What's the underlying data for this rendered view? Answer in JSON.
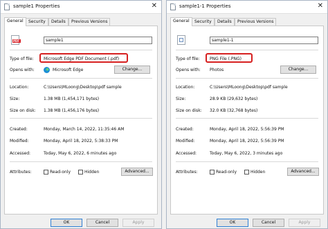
{
  "dialogs": [
    {
      "title": "sample1 Properties",
      "tabs": [
        "General",
        "Security",
        "Details",
        "Previous Versions"
      ],
      "file_name": "sample1",
      "type_label": "Type of file:",
      "type_value": "Microsoft Edge PDF Document (.pdf)",
      "opens_label": "Opens with:",
      "opens_value": "Microsoft Edge",
      "change_button": "Change...",
      "location_label": "Location:",
      "location_value": "C:\\Users\\MLoong\\Desktop\\pdf sample",
      "size_label": "Size:",
      "size_value": "1.38 MB (1,454,171 bytes)",
      "size_on_disk_label": "Size on disk:",
      "size_on_disk_value": "1.38 MB (1,456,176 bytes)",
      "created_label": "Created:",
      "created_value": "Monday, March 14, 2022, 11:35:46 AM",
      "modified_label": "Modified:",
      "modified_value": "Monday, April 18, 2022, 5:38:33 PM",
      "accessed_label": "Accessed:",
      "accessed_value": "Today, May 6, 2022, 6 minutes ago",
      "attributes_label": "Attributes:",
      "readonly_label": "Read-only",
      "hidden_label": "Hidden",
      "advanced_button": "Advanced...",
      "ok_button": "OK",
      "cancel_button": "Cancel",
      "apply_button": "Apply"
    },
    {
      "title": "sample1-1 Properties",
      "tabs": [
        "General",
        "Security",
        "Details",
        "Previous Versions"
      ],
      "file_name": "sample1-1",
      "type_label": "Type of file:",
      "type_value": "PNG File (.PNG)",
      "opens_label": "Opens with:",
      "opens_value": "Photos",
      "change_button": "Change...",
      "location_label": "Location:",
      "location_value": "C:\\Users\\MLoong\\Desktop\\pdf sample",
      "size_label": "Size:",
      "size_value": "28.9 KB (29,632 bytes)",
      "size_on_disk_label": "Size on disk:",
      "size_on_disk_value": "32.0 KB (32,768 bytes)",
      "created_label": "Created:",
      "created_value": "Monday, April 18, 2022, 5:56:39 PM",
      "modified_label": "Modified:",
      "modified_value": "Monday, April 18, 2022, 5:56:39 PM",
      "accessed_label": "Accessed:",
      "accessed_value": "Today, May 6, 2022, 3 minutes ago",
      "attributes_label": "Attributes:",
      "readonly_label": "Read-only",
      "hidden_label": "Hidden",
      "advanced_button": "Advanced...",
      "ok_button": "OK",
      "cancel_button": "Cancel",
      "apply_button": "Apply"
    }
  ],
  "colors": {
    "highlight": "#d61f1f",
    "window_bg": "#f0f0f0"
  }
}
